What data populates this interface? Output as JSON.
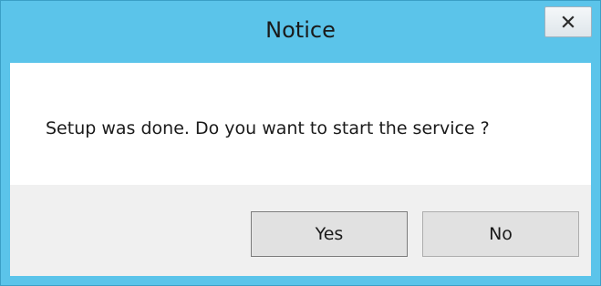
{
  "dialog": {
    "title": "Notice",
    "message": "Setup was done. Do you want to start the service ?",
    "buttons": {
      "yes_label": "Yes",
      "no_label": "No"
    },
    "close_icon": "close-icon"
  },
  "colors": {
    "titlebar": "#5bc4ea",
    "content_background": "#ffffff",
    "footer_background": "#f0f0f0",
    "button_background": "#e1e1e1"
  }
}
